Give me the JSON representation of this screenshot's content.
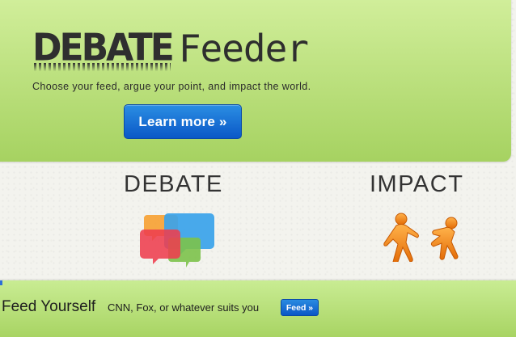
{
  "hero": {
    "logo_debate": "DEBATE",
    "logo_feeder": "Feeder",
    "tagline": "Choose your feed, argue your point, and impact the world.",
    "learn_more_label": "Learn more »"
  },
  "features": {
    "debate_title": "DEBATE",
    "impact_title": "IMPACT",
    "debate_icon": "speech-bubbles-icon",
    "impact_icon": "pushing-figures-icon"
  },
  "footer": {
    "title": "Feed Yourself",
    "subtitle": "CNN, Fox, or whatever suits you",
    "feed_button_label": "Feed »"
  },
  "colors": {
    "hero_green": "#b9e07a",
    "button_blue": "#0a58c7",
    "figure_orange": "#f08a14"
  }
}
